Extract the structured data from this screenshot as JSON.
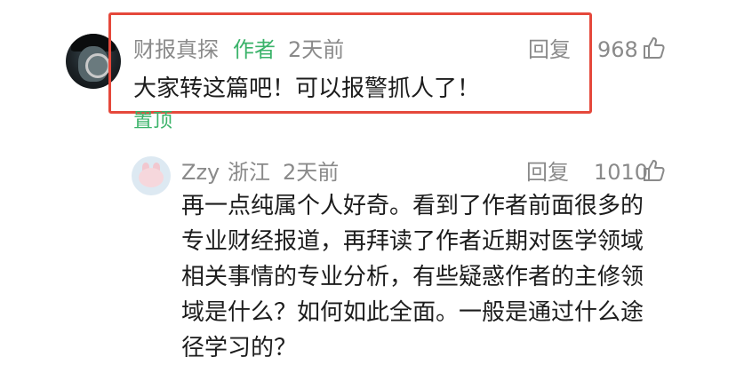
{
  "comment": {
    "username": "财报真探",
    "author_tag": "作者",
    "time": "2天前",
    "reply_label": "回复",
    "likes": "968",
    "text": "大家转这篇吧！可以报警抓人了！",
    "pinned_label": "置顶"
  },
  "reply": {
    "username": "Zzy",
    "location": "浙江",
    "time": "2天前",
    "reply_label": "回复",
    "likes": "1010",
    "lines": [
      "再一点纯属个人好奇。看到了作者前面很多的",
      "专业财经报道，再拜读了作者近期对医学领域",
      "相关事情的专业分析，有些疑惑作者的主修领",
      "域是什么？如何如此全面。一般是通过什么途",
      "径学习的？"
    ]
  },
  "colors": {
    "highlight": "#e5483b",
    "author_green": "#3bb36a",
    "meta_gray": "#8a8a8a"
  },
  "icons": {
    "like": "thumbs-up-icon"
  }
}
